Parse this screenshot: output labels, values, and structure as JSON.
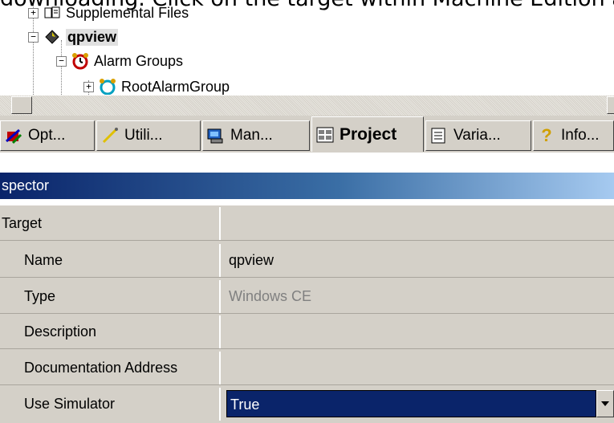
{
  "caption": "downloading. Click on the target within Machine Edition a",
  "tree": {
    "items": [
      {
        "label": "Supplemental Files",
        "expander": "+",
        "icon": "files-icon"
      },
      {
        "label": "qpview",
        "expander": "−",
        "icon": "target-icon",
        "bold": true
      },
      {
        "label": "Alarm Groups",
        "expander": "−",
        "icon": "alarm-clock-icon"
      },
      {
        "label": "RootAlarmGroup",
        "expander": "+",
        "icon": "alarm-group-icon"
      }
    ]
  },
  "tabs": [
    {
      "label": "Opt...",
      "icon": "options-icon"
    },
    {
      "label": "Utili...",
      "icon": "utilities-icon"
    },
    {
      "label": "Man...",
      "icon": "manuals-icon"
    },
    {
      "label": "Project",
      "icon": "project-icon",
      "active": true
    },
    {
      "label": "Varia...",
      "icon": "variables-icon"
    },
    {
      "label": "Info...",
      "icon": "info-icon"
    }
  ],
  "inspector": {
    "title": "spector",
    "rows": [
      {
        "label": "Target",
        "value": ""
      },
      {
        "label": "Name",
        "value": "qpview"
      },
      {
        "label": "Type",
        "value": "Windows CE"
      },
      {
        "label": "Description",
        "value": ""
      },
      {
        "label": "Documentation Address",
        "value": ""
      },
      {
        "label": "Use Simulator",
        "value": "True"
      }
    ]
  },
  "colors": {
    "selection": "#0a246a",
    "face": "#d4d0c8"
  }
}
